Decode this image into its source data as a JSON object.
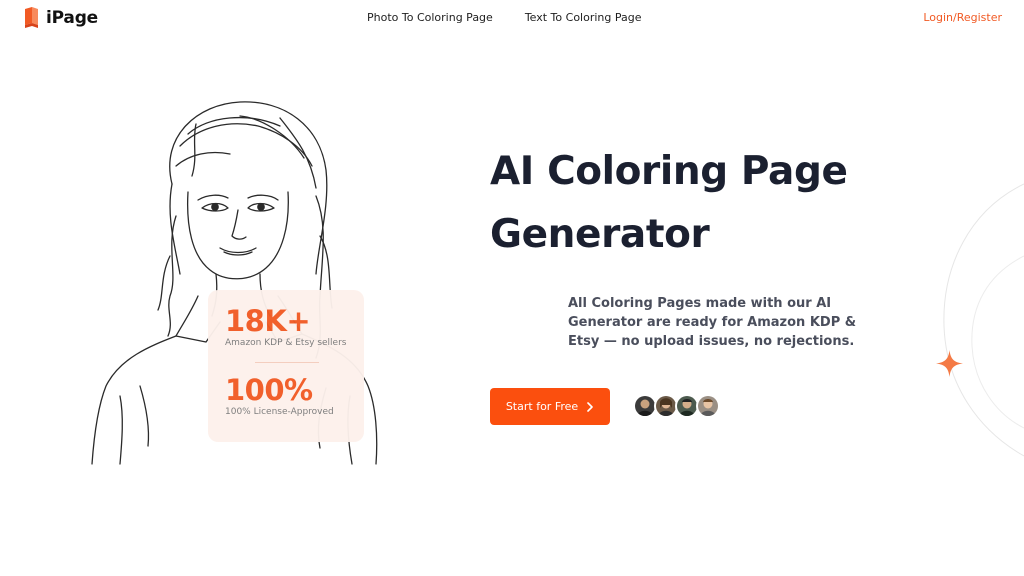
{
  "nav": {
    "brand": "iPage",
    "links": [
      "Photo To Coloring Page",
      "Text To Coloring Page"
    ],
    "login": "Login/Register"
  },
  "hero": {
    "title_line1": "AI Coloring Page",
    "title_line2": "Generator",
    "subtitle": "All Coloring Pages made with our AI Generator are ready for Amazon KDP & Etsy — no upload issues, no rejections.",
    "cta": "Start for Free"
  },
  "stats": [
    {
      "value": "18K+",
      "label": "Amazon KDP & Etsy sellers"
    },
    {
      "value": "100%",
      "label": "100% License-Approved"
    }
  ],
  "colors": {
    "accent": "#f15a24",
    "cta_bg": "#fb4f0e",
    "title": "#1b2030"
  },
  "icons": {
    "logo": "book-logo-icon",
    "cta_arrow": "chevron-right-icon",
    "decoration": "sparkle-star-icon"
  }
}
